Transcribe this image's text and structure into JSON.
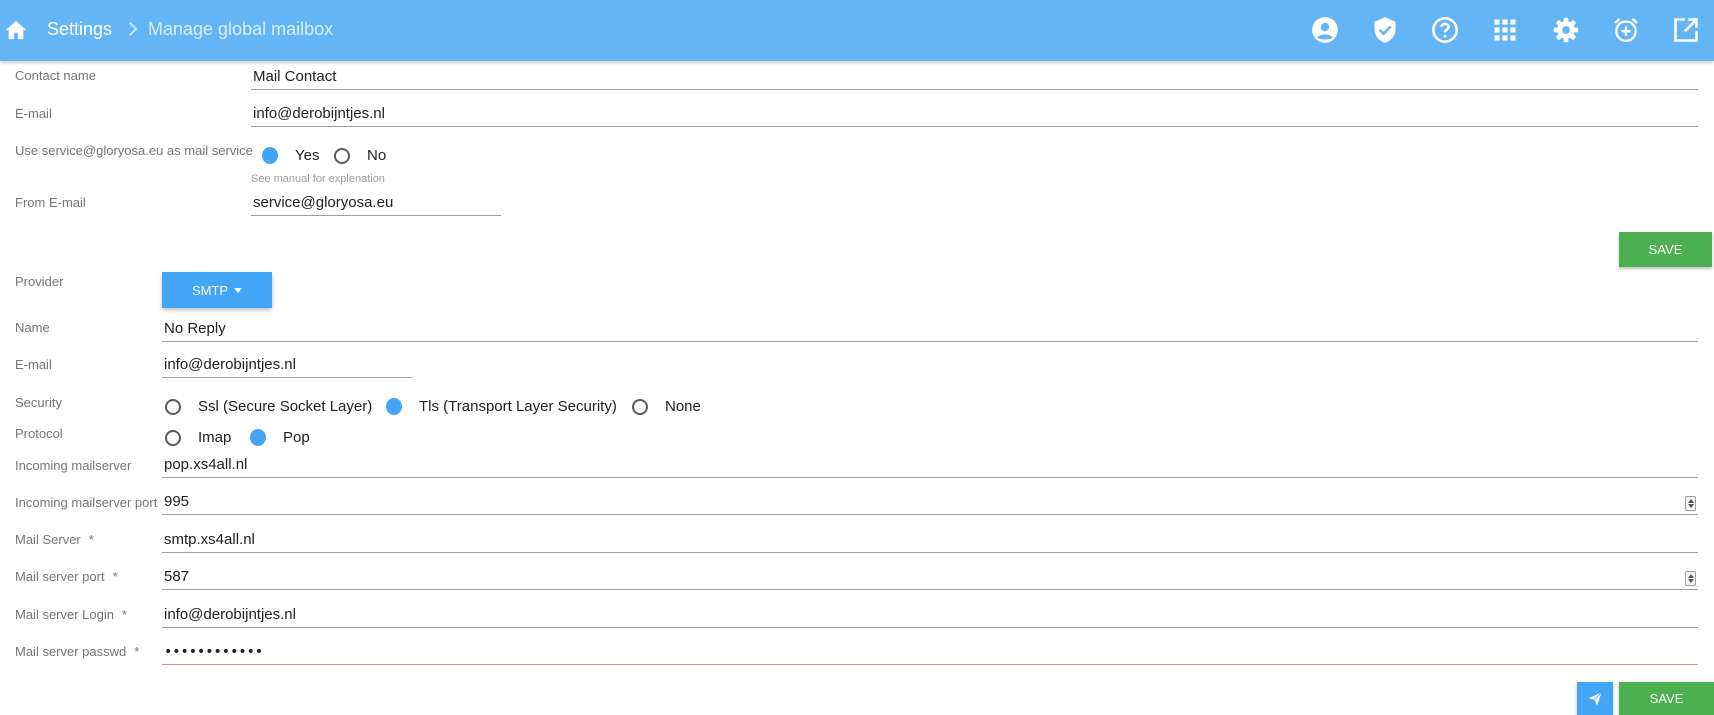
{
  "header": {
    "breadcrumb_root": "Settings",
    "breadcrumb_page": "Manage global mailbox",
    "icons": [
      "home-icon",
      "account-circle-icon",
      "verified-shield-icon",
      "help-circle-icon",
      "apps-grid-icon",
      "settings-gear-icon",
      "alarm-add-icon",
      "open-in-new-icon"
    ]
  },
  "contact": {
    "contact_name_label": "Contact name",
    "contact_name_value": "Mail Contact",
    "email_label": "E-mail",
    "email_value": "info@derobijntjes.nl",
    "use_service_label": "Use service@gloryosa.eu as mail service",
    "use_service_options": [
      "Yes",
      "No"
    ],
    "use_service_selected": "Yes",
    "manual_hint": "See manual for explenation",
    "from_email_label": "From E-mail",
    "from_email_value": "service@gloryosa.eu",
    "save_label": "SAVE"
  },
  "provider": {
    "provider_label": "Provider",
    "provider_value": "SMTP",
    "name_label": "Name",
    "name_value": "No Reply",
    "email_label": "E-mail",
    "email_value": "info@derobijntjes.nl",
    "security_label": "Security",
    "security_options": [
      "Ssl (Secure Socket Layer)",
      "Tls (Transport Layer Security)",
      "None"
    ],
    "security_selected": "Tls (Transport Layer Security)",
    "protocol_label": "Protocol",
    "protocol_options": [
      "Imap",
      "Pop"
    ],
    "protocol_selected": "Pop",
    "incoming_server_label": "Incoming mailserver",
    "incoming_server_value": "pop.xs4all.nl",
    "incoming_port_label": "Incoming mailserver port",
    "incoming_port_value": "995",
    "mail_server_label": "Mail Server",
    "mail_server_value": "smtp.xs4all.nl",
    "mail_port_label": "Mail server port",
    "mail_port_value": "587",
    "login_label": "Mail server Login",
    "login_value": "info@derobijntjes.nl",
    "passwd_label": "Mail server passwd",
    "passwd_value": "aaaaaaaaaaaa",
    "required_mark": "*",
    "save_label": "SAVE"
  },
  "colors": {
    "header": "#64b5f6",
    "primary": "#42a5f5",
    "save": "#4caf50"
  }
}
